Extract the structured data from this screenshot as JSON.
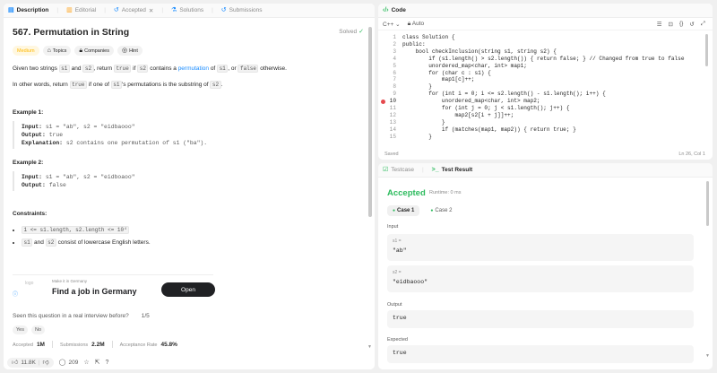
{
  "left": {
    "tabs": [
      {
        "label": "Description",
        "icon": "document-icon"
      },
      {
        "label": "Editorial",
        "icon": "book-icon"
      },
      {
        "label": "Accepted",
        "icon": "history-icon",
        "close": "✕"
      },
      {
        "label": "Solutions",
        "icon": "flask-icon"
      },
      {
        "label": "Submissions",
        "icon": "history-icon"
      }
    ],
    "title": "567. Permutation in String",
    "solved": "Solved",
    "tags": {
      "difficulty": "Medium",
      "topics": "Topics",
      "companies": "Companies",
      "hint": "Hint"
    },
    "desc1": {
      "a": "Given two strings ",
      "s1": "s1",
      "b": " and ",
      "s2": "s2",
      "c": ", return ",
      "t": "true",
      "d": " if ",
      "s2b": "s2",
      "e": " contains a ",
      "link": "permutation",
      "f": " of ",
      "s1b": "s1",
      "g": ", or ",
      "false": "false",
      "h": " otherwise."
    },
    "desc2": {
      "a": "In other words, return ",
      "t": "true",
      "b": " if one of ",
      "s1": "s1",
      "c": "'s permutations is the substring of ",
      "s2": "s2",
      "d": "."
    },
    "example1": {
      "title": "Example 1:",
      "input_label": "Input:",
      "input": " s1 = \"ab\", s2 = \"eidbaooo\"",
      "output_label": "Output:",
      "output": " true",
      "expl_label": "Explanation:",
      "expl": " s2 contains one permutation of s1 (\"ba\")."
    },
    "example2": {
      "title": "Example 2:",
      "input_label": "Input:",
      "input": " s1 = \"ab\", s2 = \"eidboaoo\"",
      "output_label": "Output:",
      "output": " false"
    },
    "constraints": {
      "title": "Constraints:",
      "c1": "1 <= s1.length, s2.length <= 10⁴",
      "c2a": "s1",
      "c2b": " and ",
      "c2c": "s2",
      "c2d": " consist of lowercase English letters."
    },
    "ad": {
      "small": "Make it in Germany",
      "big": "Find a job in Germany",
      "button": "Open",
      "logo": "logo"
    },
    "seen": {
      "question": "Seen this question in a real interview before?",
      "count": "1/5",
      "yes": "Yes",
      "no": "No"
    },
    "stats": {
      "accepted_label": "Accepted",
      "accepted": "1M",
      "subs_label": "Submissions",
      "subs": "2.2M",
      "rate_label": "Acceptance Rate",
      "rate": "45.8%"
    },
    "bottom": {
      "likes": "11.8K",
      "comments": "209"
    }
  },
  "code": {
    "tab": "Code",
    "lang": "C++",
    "mode": "Auto",
    "lines": [
      "class Solution {",
      "public:",
      "    bool checkInclusion(string s1, string s2) {",
      "        if (s1.length() > s2.length()) { return false; } // Changed from true to false",
      "        unordered_map<char, int> map1;",
      "        for (char c : s1) {",
      "            map1[c]++;",
      "        }",
      "        for (int i = 0; i <= s2.length() - s1.length(); i++) {",
      "            unordered_map<char, int> map2;",
      "            for (int j = 0; j < s1.length(); j++) {",
      "                map2[s2[i + j]]++;",
      "            }",
      "            if (matches(map1, map2)) { return true; }",
      "        }"
    ],
    "saved": "Saved",
    "cursor": "Ln 26, Col 1"
  },
  "result": {
    "tabs": [
      {
        "label": "Testcase",
        "icon": "check-box-icon"
      },
      {
        "label": "Test Result",
        "icon": "terminal-icon"
      }
    ],
    "status": "Accepted",
    "runtime": "Runtime: 0 ms",
    "cases": [
      "Case 1",
      "Case 2"
    ],
    "input_label": "Input",
    "s1_label": "s1 =",
    "s1_value": "\"ab\"",
    "s2_label": "s2 =",
    "s2_value": "\"eidbaooo\"",
    "output_label": "Output",
    "output_value": "true",
    "expected_label": "Expected",
    "expected_value": "true"
  }
}
